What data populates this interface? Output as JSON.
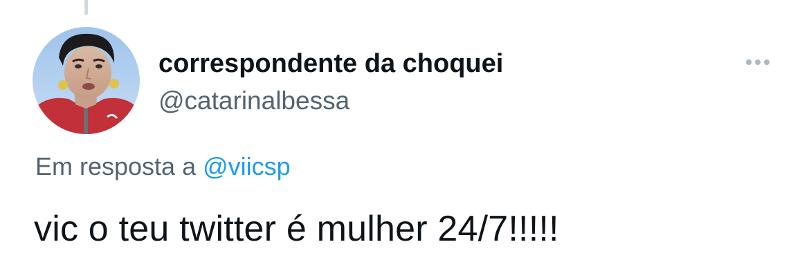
{
  "tweet": {
    "author": {
      "display_name": "correspondente da choquei",
      "handle": "@catarinalbessa",
      "avatar": "profile-photo"
    },
    "menu_icon": "more-horizontal-icon",
    "reply_to": {
      "prefix": "Em resposta a",
      "mention": "@viicsp"
    },
    "text": "vic o teu twitter é mulher 24/7!!!!!"
  },
  "colors": {
    "text_primary": "#0f1419",
    "text_secondary": "#536471",
    "mention": "#1d9bf0",
    "thread_line": "#cfd9de"
  }
}
